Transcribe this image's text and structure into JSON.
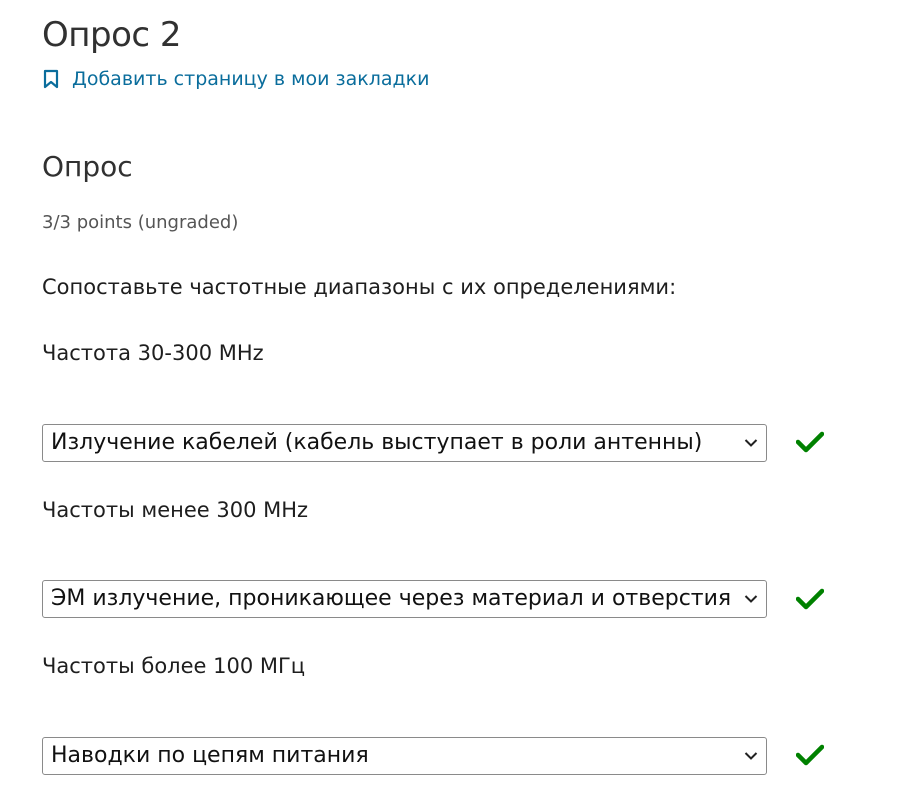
{
  "page": {
    "title": "Опрос 2",
    "bookmark_label": "Добавить страницу в мои закладки"
  },
  "problem": {
    "heading": "Опрос",
    "points": "3/3 points (ungraded)",
    "prompt": "Сопоставьте частотные диапазоны с их определениями:",
    "items": [
      {
        "label": "Частота 30-300 MHz",
        "selected": "Излучение кабелей (кабель выступает в роли антенны)",
        "status": "correct"
      },
      {
        "label": "Частоты менее 300 MHz",
        "selected": "ЭМ излучение, проникающее через материал и отверстия",
        "status": "correct"
      },
      {
        "label": "Частоты более 100 МГц",
        "selected": "Наводки по цепям питания",
        "status": "correct"
      }
    ]
  },
  "colors": {
    "link": "#0a6d9c",
    "correct": "#008100"
  },
  "icons": {
    "bookmark": "bookmark-outline-icon",
    "dropdown": "chevron-down-icon",
    "status": "checkmark-icon"
  }
}
